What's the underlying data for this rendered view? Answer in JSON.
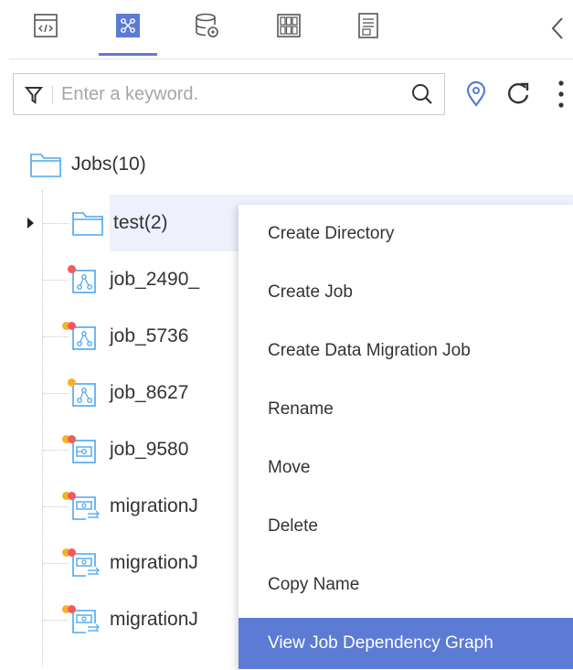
{
  "toolbar": {
    "tabs": [
      {
        "icon": "code-icon"
      },
      {
        "icon": "workflow-icon",
        "active": true
      },
      {
        "icon": "database-icon"
      },
      {
        "icon": "table-grid-icon"
      },
      {
        "icon": "document-icon"
      }
    ],
    "collapse_icon": "chevron-left-icon"
  },
  "search": {
    "placeholder": "Enter a keyword.",
    "value": ""
  },
  "tree": {
    "root": {
      "label": "Jobs",
      "count": "(10)"
    },
    "items": [
      {
        "label": "test",
        "count": "(2)",
        "type": "folder",
        "selected": true
      },
      {
        "label": "job_2490_",
        "type": "batch-job",
        "status_colors": [
          "#f25b5b"
        ]
      },
      {
        "label": "job_5736",
        "type": "batch-job",
        "status_colors": [
          "#f5b229",
          "#f25b5b"
        ]
      },
      {
        "label": "job_8627",
        "type": "batch-job",
        "status_colors": [
          "#f5b229"
        ]
      },
      {
        "label": "job_9580",
        "type": "realtime-job",
        "status_colors": [
          "#f5b229",
          "#f25b5b"
        ]
      },
      {
        "label": "migrationJ",
        "type": "migration-job",
        "status_colors": [
          "#f5b229",
          "#f25b5b"
        ]
      },
      {
        "label": "migrationJ",
        "type": "migration-job",
        "status_colors": [
          "#f5b229",
          "#f25b5b"
        ]
      },
      {
        "label": "migrationJ",
        "type": "migration-job",
        "status_colors": [
          "#f5b229",
          "#f25b5b"
        ]
      }
    ]
  },
  "context_menu": {
    "items": [
      {
        "label": "Create Directory"
      },
      {
        "label": "Create Job"
      },
      {
        "label": "Create Data Migration Job"
      },
      {
        "label": "Rename"
      },
      {
        "label": "Move"
      },
      {
        "label": "Delete"
      },
      {
        "label": "Copy Name"
      },
      {
        "label": "View Job Dependency Graph",
        "active": true
      }
    ]
  },
  "colors": {
    "accent": "#5b7bd5",
    "icon_blue": "#4aa7f0",
    "warning": "#f5b229",
    "error": "#f25b5b"
  }
}
